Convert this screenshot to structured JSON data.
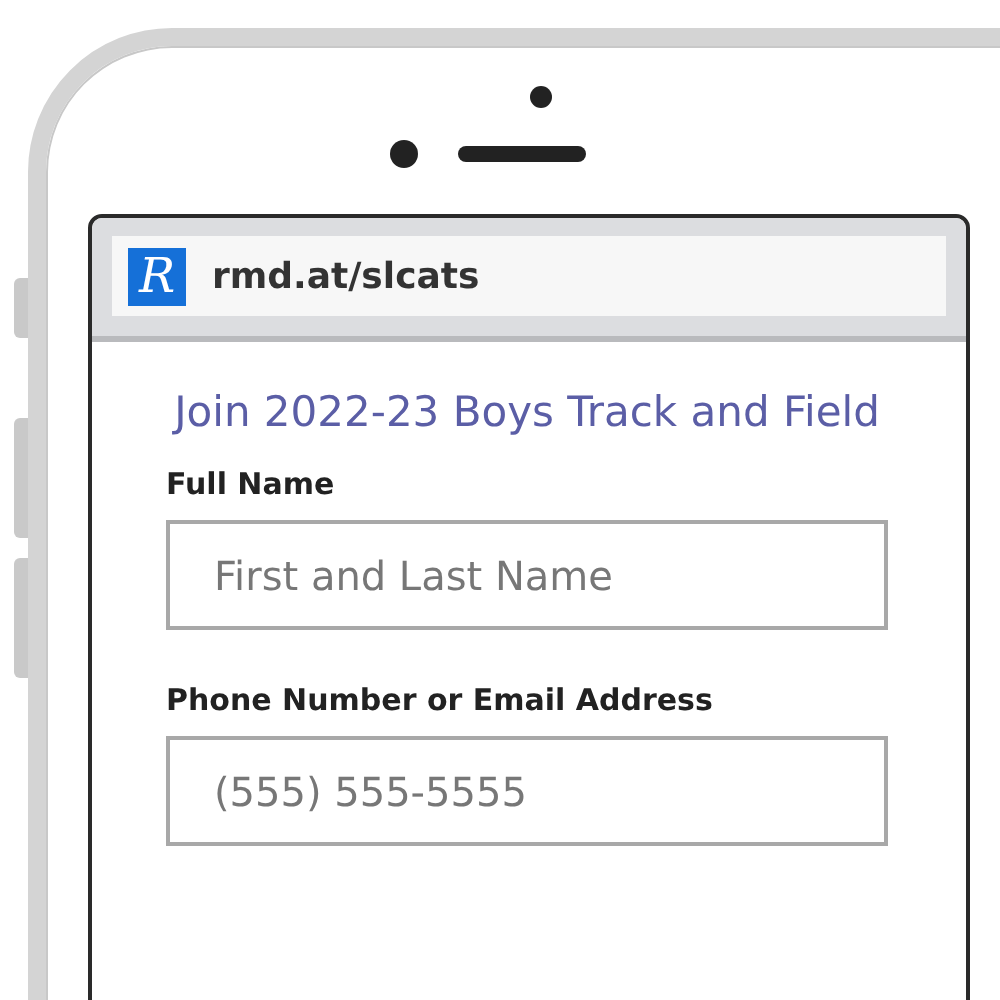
{
  "browser": {
    "logo_letter": "R",
    "url": "rmd.at/slcats"
  },
  "form": {
    "title": "Join 2022-23 Boys Track and Field",
    "fields": [
      {
        "label": "Full Name",
        "placeholder": "First and Last Name"
      },
      {
        "label": "Phone Number or Email Address",
        "placeholder": "(555) 555-5555"
      }
    ]
  }
}
